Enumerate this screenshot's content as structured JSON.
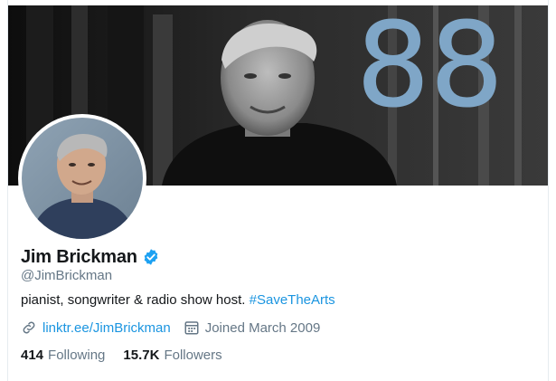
{
  "profile": {
    "display_name": "Jim Brickman",
    "handle": "@JimBrickman",
    "bio_text": "pianist, songwriter & radio show host. ",
    "bio_hashtag": "#SaveTheArts",
    "link": "linktr.ee/JimBrickman",
    "joined": "Joined March 2009",
    "banner_overlay_text": "88"
  },
  "stats": {
    "following_count": "414",
    "following_label": "Following",
    "followers_count": "15.7K",
    "followers_label": "Followers"
  },
  "icons": {
    "verified": "verified-badge-icon",
    "link": "link-icon",
    "calendar": "calendar-icon"
  },
  "colors": {
    "accent": "#1b95e0",
    "verified": "#1da1f2",
    "banner_numeral": "#7fa6c7",
    "primary_text": "#14171a",
    "secondary_text": "#657786"
  }
}
